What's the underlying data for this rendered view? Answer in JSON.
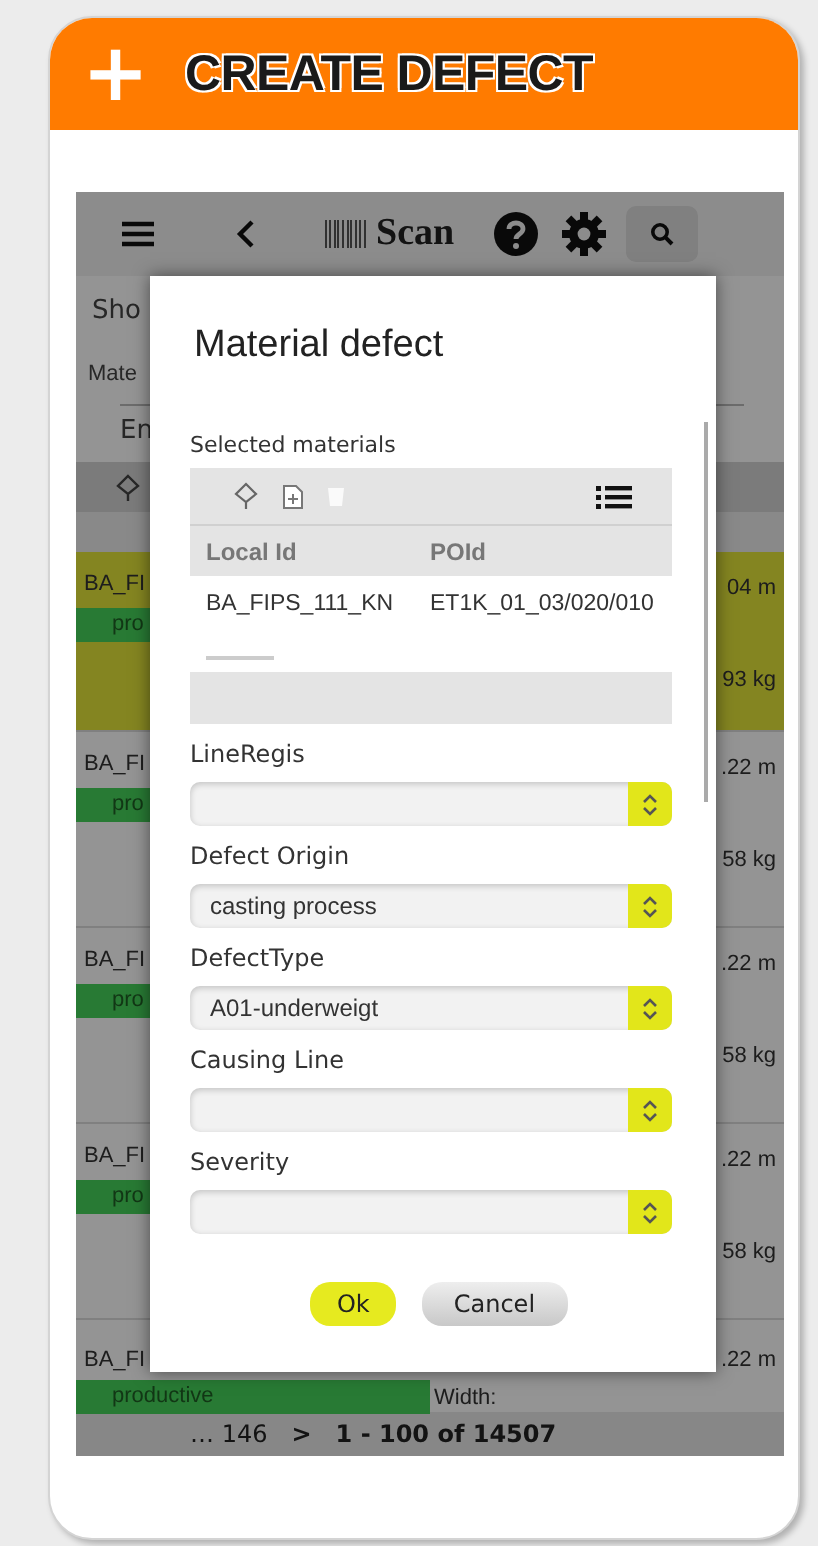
{
  "header": {
    "icon": "+",
    "title": "CREATE DEFECT"
  },
  "toolbar": {
    "scan_label": "Scan"
  },
  "background": {
    "texts": [
      "Sho",
      "Mate",
      "En"
    ],
    "rows": [
      {
        "id": "BA_FI",
        "status": "pro",
        "length": "04 m",
        "weight": "93 kg",
        "selected": true
      },
      {
        "id": "BA_FI",
        "status": "pro",
        "length": ".22 m",
        "weight": "58 kg",
        "selected": false
      },
      {
        "id": "BA_FI",
        "status": "pro",
        "length": ".22 m",
        "weight": "58 kg",
        "selected": false
      },
      {
        "id": "BA_FI",
        "status": "pro",
        "length": ".22 m",
        "weight": "58 kg",
        "selected": false
      }
    ],
    "last_row": {
      "id": "BA_FI",
      "status": "productive",
      "width_label": "Width:",
      "length": ".22 m"
    }
  },
  "pagination": {
    "ellipsis": "…",
    "page": "146",
    "next": ">",
    "range": "1 - 100 of 14507"
  },
  "dialog": {
    "title": "Material defect",
    "materials_label": "Selected materials",
    "table": {
      "columns": [
        "Local Id",
        "POId"
      ],
      "rows": [
        [
          "BA_FIPS_111_KN",
          "ET1K_01_03/020/010"
        ]
      ]
    },
    "fields": [
      {
        "label": "LineRegis"
      },
      {
        "label": "Defect Origin",
        "value": "casting process"
      },
      {
        "label": "DefectType",
        "value": "A01-underweigt"
      },
      {
        "label": "Causing Line"
      },
      {
        "label": "Severity"
      }
    ],
    "buttons": [
      {
        "label": "Ok",
        "kind": "primary"
      },
      {
        "label": "Cancel",
        "kind": "secondary"
      }
    ]
  }
}
